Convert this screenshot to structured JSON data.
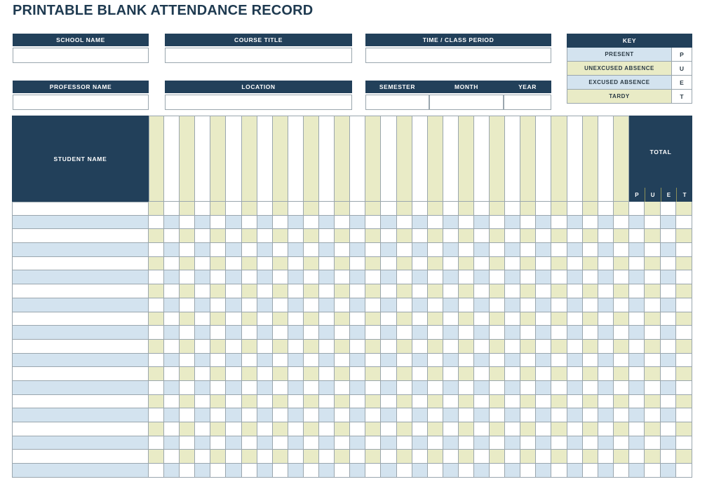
{
  "page": {
    "title": "PRINTABLE BLANK ATTENDANCE RECORD"
  },
  "colors": {
    "navy": "#22405A",
    "title_navy": "#1E3A50",
    "tint_blue": "#D3E3EF",
    "tint_yellow": "#E9EBC6",
    "border": "#9aa6ae"
  },
  "header_fields": [
    {
      "label": "SCHOOL NAME",
      "value": ""
    },
    {
      "label": "COURSE TITLE",
      "value": ""
    },
    {
      "label": "TIME / CLASS PERIOD",
      "value": ""
    },
    {
      "label": "PROFESSOR NAME",
      "value": ""
    },
    {
      "label": "LOCATION",
      "value": ""
    },
    {
      "label": "SEMESTER",
      "value": ""
    },
    {
      "label": "MONTH",
      "value": ""
    },
    {
      "label": "YEAR",
      "value": ""
    }
  ],
  "key": {
    "title": "KEY",
    "rows": [
      {
        "label": "PRESENT",
        "code": "P",
        "tint": "blue"
      },
      {
        "label": "UNEXCUSED ABSENCE",
        "code": "U",
        "tint": "yellow"
      },
      {
        "label": "EXCUSED ABSENCE",
        "code": "E",
        "tint": "blue"
      },
      {
        "label": "TARDY",
        "code": "T",
        "tint": "yellow"
      }
    ]
  },
  "grid": {
    "student_name_header": "STUDENT NAME",
    "total_header": "TOTAL",
    "total_subheaders": [
      "P",
      "U",
      "E",
      "T"
    ],
    "day_column_count": 31,
    "row_count": 20,
    "day_column_width": 22.1,
    "row_height": 19.7,
    "student_names": [
      "",
      "",
      "",
      "",
      "",
      "",
      "",
      "",
      "",
      "",
      "",
      "",
      "",
      "",
      "",
      "",
      "",
      "",
      "",
      ""
    ]
  }
}
